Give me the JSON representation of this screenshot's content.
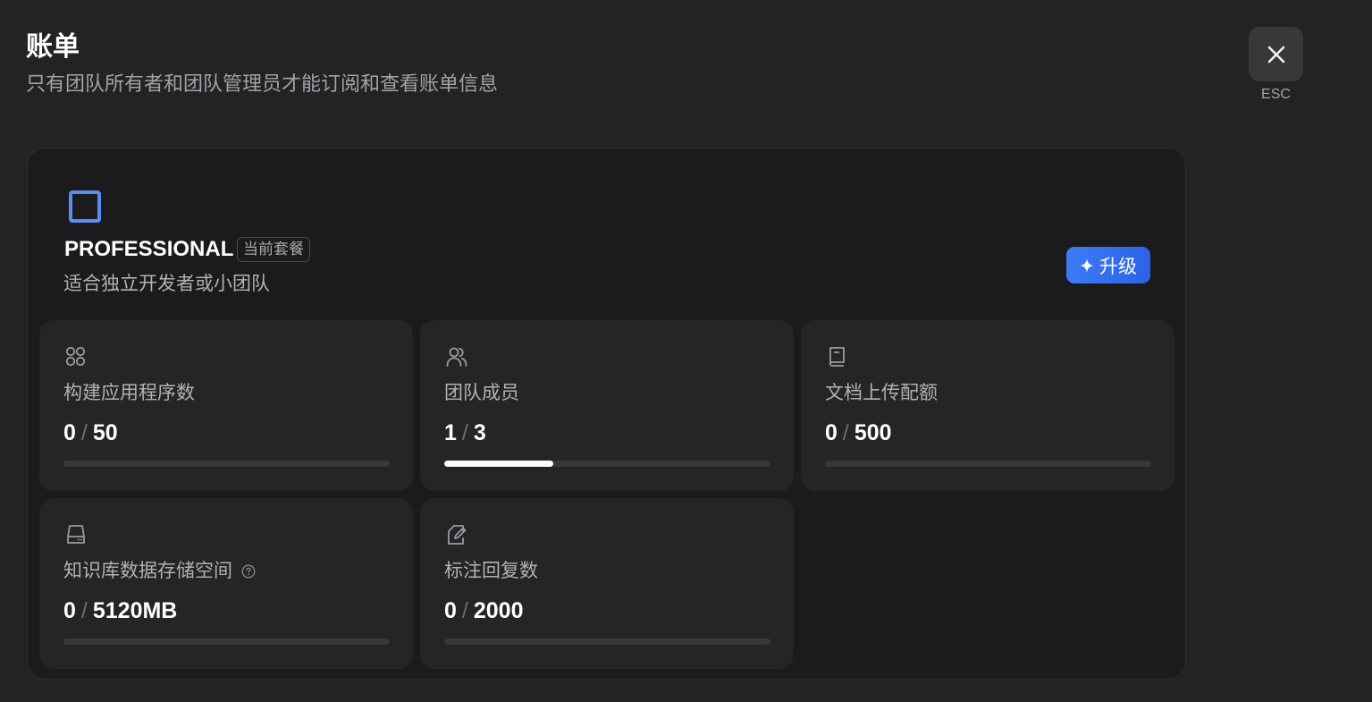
{
  "header": {
    "title": "账单",
    "subtitle": "只有团队所有者和团队管理员才能订阅和查看账单信息"
  },
  "close": {
    "esc_label": "ESC",
    "icon": "close-icon"
  },
  "plan": {
    "name": "PROFESSIONAL",
    "badge": "当前套餐",
    "description": "适合独立开发者或小团队",
    "icon": "square-plan-icon",
    "accent_color": "#5b8def",
    "upgrade_label": "升级",
    "upgrade_icon": "sparkle-icon"
  },
  "quotas": [
    {
      "icon": "apps-grid-icon",
      "label": "构建应用程序数",
      "used": "0",
      "limit": "50",
      "fraction": 0
    },
    {
      "icon": "users-icon",
      "label": "团队成员",
      "used": "1",
      "limit": "3",
      "fraction": 0.333
    },
    {
      "icon": "book-icon",
      "label": "文档上传配额",
      "used": "0",
      "limit": "500",
      "fraction": 0
    },
    {
      "icon": "hard-drive-icon",
      "label": "知识库数据存储空间",
      "help_icon": "help-circle-icon",
      "used": "0",
      "limit": "5120MB",
      "fraction": 0
    },
    {
      "icon": "annotation-edit-icon",
      "label": "标注回复数",
      "used": "0",
      "limit": "2000",
      "fraction": 0
    }
  ],
  "colors": {
    "background": "#232325",
    "card": "#1b1b1d",
    "quota_card": "#252527",
    "primary_button": "#2a63e6"
  }
}
